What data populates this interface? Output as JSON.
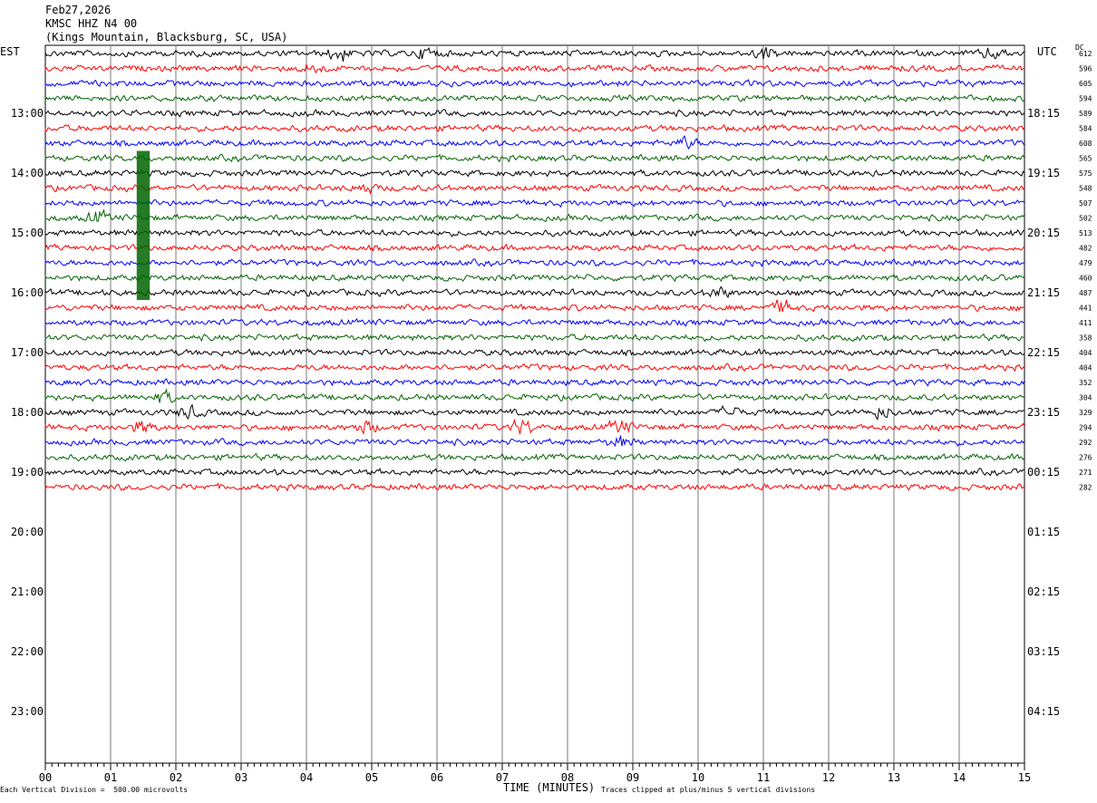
{
  "header": {
    "date": "Feb27,2026",
    "station": "KMSC HHZ N4 00",
    "location": "(Kings Mountain, Blacksburg, SC, USA)"
  },
  "labels": {
    "left_tz": "EST",
    "right_tz": "UTC",
    "dc": "DC"
  },
  "footer": {
    "scale": "Each Vertical Division =  500.00 microvolts",
    "xlabel": "TIME (MINUTES)",
    "clip_note": "Traces clipped at plus/minus 5 vertical divisions"
  },
  "chart_data": {
    "type": "line",
    "title": "KMSC HHZ N4 00",
    "xlabel": "TIME (MINUTES)",
    "x_ticks": [
      "00",
      "01",
      "02",
      "03",
      "04",
      "05",
      "06",
      "07",
      "08",
      "09",
      "10",
      "11",
      "12",
      "13",
      "14",
      "15"
    ],
    "xlim": [
      0,
      15
    ],
    "est_labels": [
      "13:00",
      "14:00",
      "15:00",
      "16:00",
      "17:00",
      "18:00",
      "19:00",
      "20:00",
      "21:00",
      "22:00",
      "23:00"
    ],
    "utc_labels": [
      "18:15",
      "19:15",
      "20:15",
      "21:15",
      "22:15",
      "23:15",
      "00:15",
      "01:15",
      "02:15",
      "03:15",
      "04:15"
    ],
    "trace_colors": [
      "#000000",
      "#ff0000",
      "#0000ff",
      "#006400"
    ],
    "dc_values": [
      "612",
      "596",
      "605",
      "594",
      "589",
      "584",
      "608",
      "565",
      "575",
      "548",
      "507",
      "502",
      "513",
      "482",
      "479",
      "460",
      "487",
      "441",
      "411",
      "358",
      "404",
      "404",
      "352",
      "304",
      "329",
      "294",
      "292",
      "276",
      "271",
      "282"
    ],
    "traces_per_hour": 4,
    "trace_count": 30,
    "events": [
      {
        "trace": 0,
        "minute": 4.5,
        "amp": 2.5
      },
      {
        "trace": 0,
        "minute": 5.85,
        "amp": 2.0
      },
      {
        "trace": 0,
        "minute": 11.0,
        "amp": 2.0
      },
      {
        "trace": 0,
        "minute": 14.5,
        "amp": 1.8
      },
      {
        "trace": 1,
        "minute": 4.1,
        "amp": 1.6
      },
      {
        "trace": 6,
        "minute": 9.8,
        "amp": 1.8
      },
      {
        "trace": 9,
        "minute": 4.9,
        "amp": 1.6
      },
      {
        "trace": 11,
        "minute": 0.8,
        "amp": 1.8
      },
      {
        "trace": 16,
        "minute": 10.3,
        "amp": 2.0
      },
      {
        "trace": 17,
        "minute": 11.3,
        "amp": 2.5
      },
      {
        "trace": 23,
        "minute": 1.8,
        "amp": 1.8
      },
      {
        "trace": 24,
        "minute": 2.2,
        "amp": 2.0
      },
      {
        "trace": 24,
        "minute": 10.5,
        "amp": 1.8
      },
      {
        "trace": 24,
        "minute": 12.8,
        "amp": 2.0
      },
      {
        "trace": 25,
        "minute": 1.5,
        "amp": 2.0
      },
      {
        "trace": 25,
        "minute": 4.9,
        "amp": 2.0
      },
      {
        "trace": 25,
        "minute": 7.3,
        "amp": 2.2
      },
      {
        "trace": 25,
        "minute": 8.8,
        "amp": 2.0
      },
      {
        "trace": 26,
        "minute": 8.8,
        "amp": 1.6
      }
    ],
    "clip_block": {
      "first_trace": 7,
      "last_trace": 16,
      "minute": 1.4,
      "width_minutes": 0.2
    }
  }
}
